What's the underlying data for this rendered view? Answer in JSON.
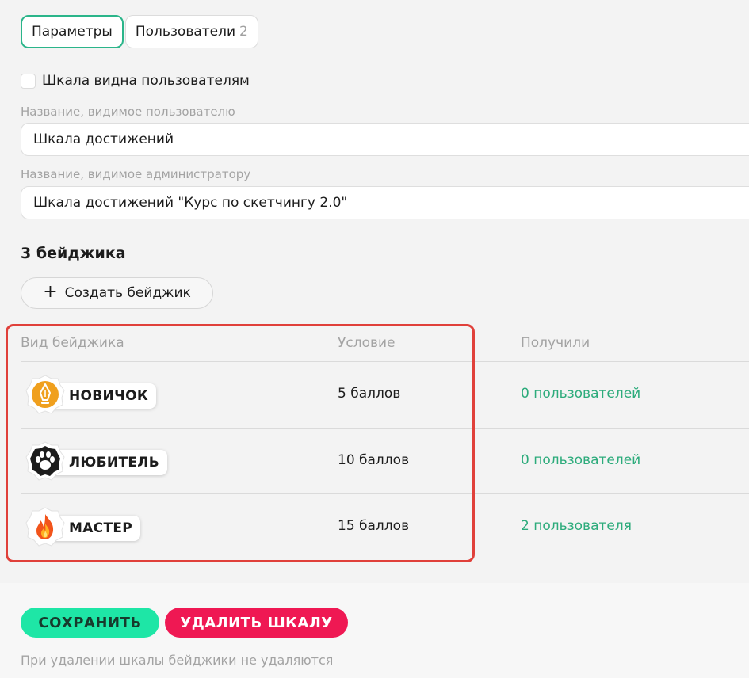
{
  "tabs": [
    {
      "label": "Параметры",
      "count": ""
    },
    {
      "label": "Пользователи",
      "count": "2"
    }
  ],
  "visibility": {
    "label": "Шкала видна пользователям",
    "checked": false
  },
  "fields": {
    "user_name_label": "Название, видимое пользователю",
    "user_name_value": "Шкала достижений",
    "admin_name_label": "Название, видимое администратору",
    "admin_name_value": "Шкала достижений \"Курс по скетчингу 2.0\""
  },
  "badges_title": "3 бейджика",
  "create_button": "Создать бейджик",
  "table": {
    "headers": [
      "Вид бейджика",
      "Условие",
      "Получили"
    ],
    "rows": [
      {
        "name": "НОВИЧОК",
        "condition": "5 баллов",
        "received": "0 пользователей",
        "icon": "fountain-pen-icon",
        "color": "#f0a01e"
      },
      {
        "name": "ЛЮБИТЕЛЬ",
        "condition": "10 баллов",
        "received": "0 пользователей",
        "icon": "paw-icon",
        "color": "#1c1c1c"
      },
      {
        "name": "МАСТЕР",
        "condition": "15 баллов",
        "received": "2 пользователя",
        "icon": "flame-icon",
        "color": "#ffffff"
      }
    ]
  },
  "actions": {
    "save": "СОХРАНИТЬ",
    "delete": "УДАЛИТЬ ШКАЛУ",
    "note": "При удалении шкалы бейджики не удаляются"
  },
  "colors": {
    "accent": "#2bb58a",
    "save": "#1ee6a6",
    "delete": "#ef1853",
    "link": "#2cab7b",
    "highlight": "#e0403a"
  }
}
